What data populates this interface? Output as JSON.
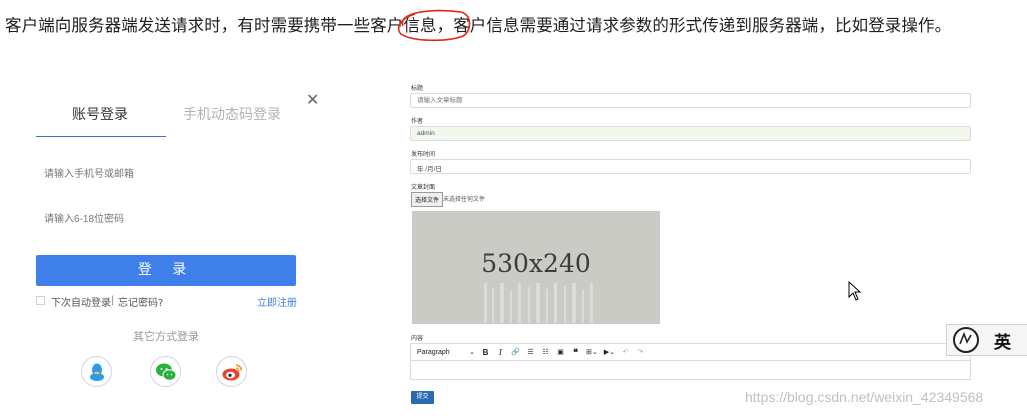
{
  "intro": {
    "before": "客户端向服务器端发送请求时，有时需要携带一些",
    "highlight": "客户信息",
    "after": "，客户信息需要通过请求参数的形式传递到服务器端，比如登录操作。"
  },
  "login": {
    "tab_account": "账号登录",
    "tab_phone": "手机动态码登录",
    "close_icon": "close-icon",
    "phone_placeholder": "请输入手机号或邮箱",
    "password_placeholder": "请输入6-18位密码",
    "login_button": "登 录",
    "auto_login": "下次自动登录",
    "separator": "|",
    "forgot": "忘记密码?",
    "register": "立即注册",
    "other_methods": "其它方式登录",
    "social": [
      "qq-icon",
      "wechat-icon",
      "weibo-icon"
    ],
    "accent": "#3f7fe9"
  },
  "form": {
    "title_label": "标题",
    "title_placeholder": "请输入文章标题",
    "author_label": "作者",
    "author_value": "admin",
    "date_label": "发布时间",
    "date_value": "年 /月/日",
    "cover_label": "文章封面",
    "file_button": "选择文件",
    "file_none": "未选择任何文件",
    "cover_placeholder": "530x240",
    "content_label": "内容",
    "toolbar_paragraph": "Paragraph",
    "toolbar_bold": "B",
    "toolbar_italic": "I",
    "submit_label": "提交"
  },
  "ime": {
    "mode": "英"
  },
  "watermark": "https://blog.csdn.net/weixin_42349568"
}
